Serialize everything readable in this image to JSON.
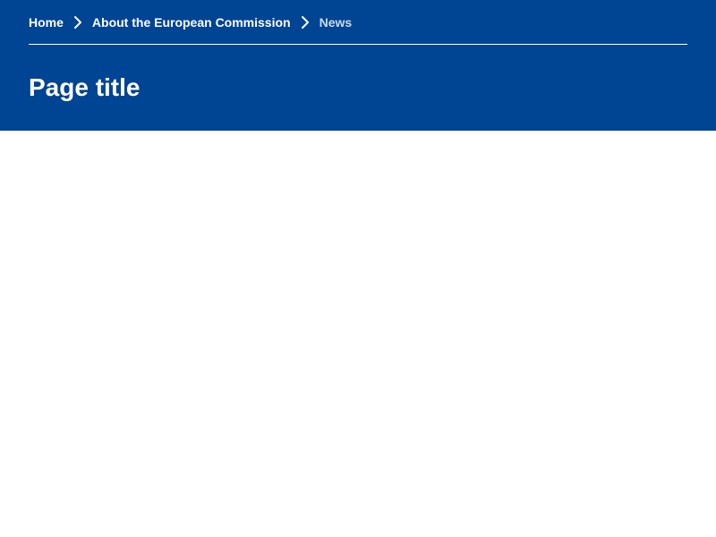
{
  "breadcrumb": {
    "items": [
      {
        "label": "Home"
      },
      {
        "label": "About the European Commission"
      }
    ],
    "current": "News"
  },
  "header": {
    "title": "Page title"
  },
  "colors": {
    "header_background": "#004494",
    "text": "#ffffff",
    "current_crumb": "#cfd8ea"
  },
  "icons": {
    "separator": "chevron-right-icon"
  }
}
